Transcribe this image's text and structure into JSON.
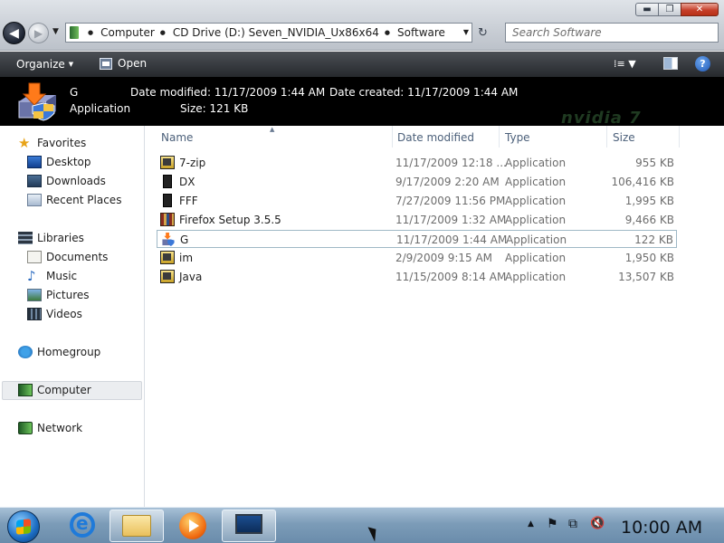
{
  "window": {
    "buttons": {
      "minimize": "▬",
      "maximize": "❐",
      "close": "✕"
    }
  },
  "navigation": {
    "back_glyph": "◀",
    "forward_glyph": "▶",
    "history_glyph": "▼"
  },
  "address": {
    "breadcrumbs": [
      "Computer",
      "CD Drive (D:) Seven_NVIDIA_Ux86x64",
      "Software"
    ],
    "separator_glyph": "●",
    "dropdown_glyph": "▼",
    "refresh_glyph": "↻"
  },
  "search": {
    "placeholder": "Search Software"
  },
  "commands": {
    "organize": "Organize",
    "open": "Open",
    "caret": "▼",
    "views_glyph": "⁞≡ ▼",
    "help": "?"
  },
  "details": {
    "name": "G",
    "type": "Application",
    "date_modified_label": "Date modified:",
    "date_modified_value": "11/17/2009 1:44 AM",
    "date_created_label": "Date created:",
    "date_created_value": "11/17/2009 1:44 AM",
    "size_label": "Size:",
    "size_value": "121 KB",
    "watermark": "nvidia 7"
  },
  "sidebar": {
    "favorites": {
      "label": "Favorites",
      "items": [
        "Desktop",
        "Downloads",
        "Recent Places"
      ]
    },
    "libraries": {
      "label": "Libraries",
      "items": [
        "Documents",
        "Music",
        "Pictures",
        "Videos"
      ]
    },
    "homegroup": "Homegroup",
    "computer": "Computer",
    "network": "Network"
  },
  "columns": {
    "sort_glyph": "▲",
    "name": "Name",
    "date_modified": "Date modified",
    "type": "Type",
    "size": "Size"
  },
  "files": [
    {
      "name": "7-zip",
      "date": "11/17/2009 12:18 ...",
      "type": "Application",
      "size": "955 KB",
      "icon": "installer-icon"
    },
    {
      "name": "DX",
      "date": "9/17/2009 2:20 AM",
      "type": "Application",
      "size": "106,416 KB",
      "icon": "app-dark-icon"
    },
    {
      "name": "FFF",
      "date": "7/27/2009 11:56 PM",
      "type": "Application",
      "size": "1,995 KB",
      "icon": "app-dark-icon"
    },
    {
      "name": "Firefox Setup 3.5.5",
      "date": "11/17/2009 1:32 AM",
      "type": "Application",
      "size": "9,466 KB",
      "icon": "winrar-box-icon"
    },
    {
      "name": "G",
      "date": "11/17/2009 1:44 AM",
      "type": "Application",
      "size": "122 KB",
      "icon": "shield-installer-icon",
      "selected": true
    },
    {
      "name": "im",
      "date": "2/9/2009 9:15 AM",
      "type": "Application",
      "size": "1,950 KB",
      "icon": "installer-icon"
    },
    {
      "name": "Java",
      "date": "11/15/2009 8:14 AM",
      "type": "Application",
      "size": "13,507 KB",
      "icon": "installer-icon"
    }
  ],
  "tray": {
    "show_hidden_glyph": "▲",
    "flag_glyph": "⚑",
    "network_glyph": "⧉",
    "volume_glyph": "🔇",
    "clock": "10:00 AM"
  }
}
